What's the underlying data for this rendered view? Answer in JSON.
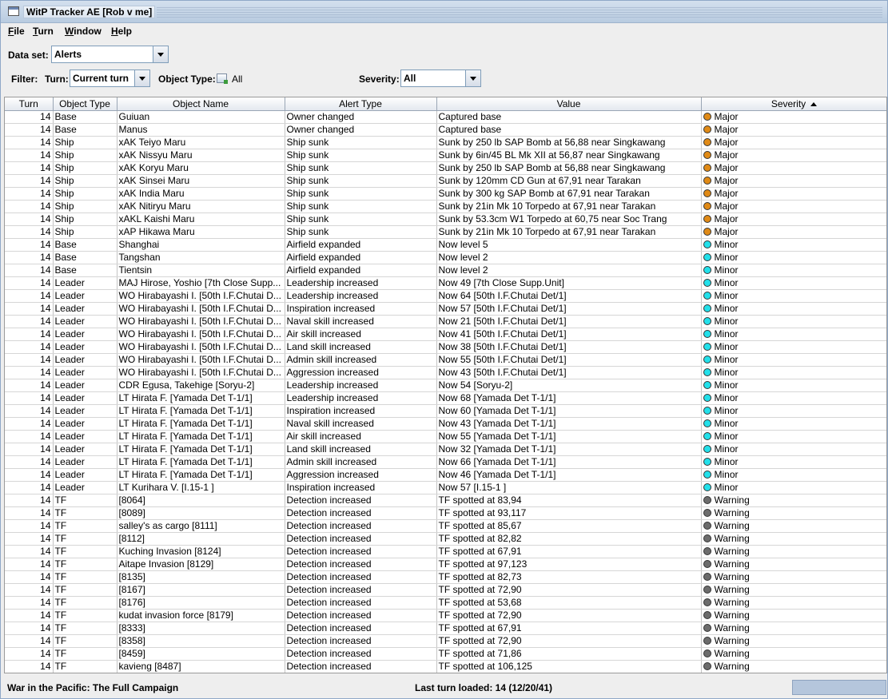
{
  "window": {
    "title": "WitP Tracker AE [Rob v me]"
  },
  "menu": [
    "File",
    "Turn",
    "Window",
    "Help"
  ],
  "dataset": {
    "label": "Data set:",
    "value": "Alerts"
  },
  "filter": {
    "label": "Filter:",
    "turn_label": "Turn:",
    "turn_value": "Current turn",
    "object_type_label": "Object Type:",
    "object_type_value": "All",
    "severity_label": "Severity:",
    "severity_value": "All"
  },
  "table": {
    "columns": [
      "Turn",
      "Object Type",
      "Object Name",
      "Alert Type",
      "Value",
      "Severity"
    ],
    "sorted_column": "Severity",
    "severity_colors": {
      "Major": "#e08a16",
      "Minor": "#22e0ea",
      "Warning": "#6c6c6c"
    },
    "rows": [
      [
        "14",
        "Base",
        "Guiuan",
        "Owner changed",
        "Captured base",
        "Major"
      ],
      [
        "14",
        "Base",
        "Manus",
        "Owner changed",
        "Captured base",
        "Major"
      ],
      [
        "14",
        "Ship",
        "xAK Teiyo Maru",
        "Ship sunk",
        "Sunk by 250 lb SAP Bomb at 56,88 near Singkawang",
        "Major"
      ],
      [
        "14",
        "Ship",
        "xAK Nissyu Maru",
        "Ship sunk",
        "Sunk by 6in/45 BL Mk XII at 56,87 near Singkawang",
        "Major"
      ],
      [
        "14",
        "Ship",
        "xAK Koryu Maru",
        "Ship sunk",
        "Sunk by 250 lb SAP Bomb at 56,88 near Singkawang",
        "Major"
      ],
      [
        "14",
        "Ship",
        "xAK Sinsei Maru",
        "Ship sunk",
        "Sunk by 120mm CD Gun at 67,91 near Tarakan",
        "Major"
      ],
      [
        "14",
        "Ship",
        "xAK India Maru",
        "Ship sunk",
        "Sunk by 300 kg SAP Bomb at 67,91 near Tarakan",
        "Major"
      ],
      [
        "14",
        "Ship",
        "xAK Nitiryu Maru",
        "Ship sunk",
        "Sunk by 21in Mk 10 Torpedo at 67,91 near Tarakan",
        "Major"
      ],
      [
        "14",
        "Ship",
        "xAKL Kaishi Maru",
        "Ship sunk",
        "Sunk by 53.3cm W1 Torpedo at 60,75 near Soc Trang",
        "Major"
      ],
      [
        "14",
        "Ship",
        "xAP Hikawa Maru",
        "Ship sunk",
        "Sunk by 21in Mk 10 Torpedo at 67,91 near Tarakan",
        "Major"
      ],
      [
        "14",
        "Base",
        "Shanghai",
        "Airfield expanded",
        "Now level 5",
        "Minor"
      ],
      [
        "14",
        "Base",
        "Tangshan",
        "Airfield expanded",
        "Now level 2",
        "Minor"
      ],
      [
        "14",
        "Base",
        "Tientsin",
        "Airfield expanded",
        "Now level 2",
        "Minor"
      ],
      [
        "14",
        "Leader",
        "MAJ Hirose, Yoshio [7th Close Supp...",
        "Leadership increased",
        "Now 49 [7th Close Supp.Unit]",
        "Minor"
      ],
      [
        "14",
        "Leader",
        "WO Hirabayashi I. [50th I.F.Chutai D...",
        "Leadership increased",
        "Now 64 [50th I.F.Chutai Det/1]",
        "Minor"
      ],
      [
        "14",
        "Leader",
        "WO Hirabayashi I. [50th I.F.Chutai D...",
        "Inspiration increased",
        "Now 57 [50th I.F.Chutai Det/1]",
        "Minor"
      ],
      [
        "14",
        "Leader",
        "WO Hirabayashi I. [50th I.F.Chutai D...",
        "Naval skill increased",
        "Now 21 [50th I.F.Chutai Det/1]",
        "Minor"
      ],
      [
        "14",
        "Leader",
        "WO Hirabayashi I. [50th I.F.Chutai D...",
        "Air skill increased",
        "Now 41 [50th I.F.Chutai Det/1]",
        "Minor"
      ],
      [
        "14",
        "Leader",
        "WO Hirabayashi I. [50th I.F.Chutai D...",
        "Land skill increased",
        "Now 38 [50th I.F.Chutai Det/1]",
        "Minor"
      ],
      [
        "14",
        "Leader",
        "WO Hirabayashi I. [50th I.F.Chutai D...",
        "Admin skill increased",
        "Now 55 [50th I.F.Chutai Det/1]",
        "Minor"
      ],
      [
        "14",
        "Leader",
        "WO Hirabayashi I. [50th I.F.Chutai D...",
        "Aggression increased",
        "Now 43 [50th I.F.Chutai Det/1]",
        "Minor"
      ],
      [
        "14",
        "Leader",
        "CDR Egusa, Takehige [Soryu-2]",
        "Leadership increased",
        "Now 54 [Soryu-2]",
        "Minor"
      ],
      [
        "14",
        "Leader",
        "LT Hirata F. [Yamada Det T-1/1]",
        "Leadership increased",
        "Now 68 [Yamada Det T-1/1]",
        "Minor"
      ],
      [
        "14",
        "Leader",
        "LT Hirata F. [Yamada Det T-1/1]",
        "Inspiration increased",
        "Now 60 [Yamada Det T-1/1]",
        "Minor"
      ],
      [
        "14",
        "Leader",
        "LT Hirata F. [Yamada Det T-1/1]",
        "Naval skill increased",
        "Now 43 [Yamada Det T-1/1]",
        "Minor"
      ],
      [
        "14",
        "Leader",
        "LT Hirata F. [Yamada Det T-1/1]",
        "Air skill increased",
        "Now 55 [Yamada Det T-1/1]",
        "Minor"
      ],
      [
        "14",
        "Leader",
        "LT Hirata F. [Yamada Det T-1/1]",
        "Land skill increased",
        "Now 32 [Yamada Det T-1/1]",
        "Minor"
      ],
      [
        "14",
        "Leader",
        "LT Hirata F. [Yamada Det T-1/1]",
        "Admin skill increased",
        "Now 66 [Yamada Det T-1/1]",
        "Minor"
      ],
      [
        "14",
        "Leader",
        "LT Hirata F. [Yamada Det T-1/1]",
        "Aggression increased",
        "Now 46 [Yamada Det T-1/1]",
        "Minor"
      ],
      [
        "14",
        "Leader",
        "LT Kurihara V. [I.15-1 ]",
        "Inspiration increased",
        "Now 57 [I.15-1 ]",
        "Minor"
      ],
      [
        "14",
        "TF",
        " [8064]",
        "Detection increased",
        "TF spotted at 83,94",
        "Warning"
      ],
      [
        "14",
        "TF",
        " [8089]",
        "Detection increased",
        "TF spotted at 93,117",
        "Warning"
      ],
      [
        "14",
        "TF",
        "salley's as cargo [8111]",
        "Detection increased",
        "TF spotted at 85,67",
        "Warning"
      ],
      [
        "14",
        "TF",
        " [8112]",
        "Detection increased",
        "TF spotted at 82,82",
        "Warning"
      ],
      [
        "14",
        "TF",
        "Kuching Invasion [8124]",
        "Detection increased",
        "TF spotted at 67,91",
        "Warning"
      ],
      [
        "14",
        "TF",
        "Aitape Invasion [8129]",
        "Detection increased",
        "TF spotted at 97,123",
        "Warning"
      ],
      [
        "14",
        "TF",
        " [8135]",
        "Detection increased",
        "TF spotted at 82,73",
        "Warning"
      ],
      [
        "14",
        "TF",
        " [8167]",
        "Detection increased",
        "TF spotted at 72,90",
        "Warning"
      ],
      [
        "14",
        "TF",
        " [8176]",
        "Detection increased",
        "TF spotted at 53,68",
        "Warning"
      ],
      [
        "14",
        "TF",
        "kudat invasion force [8179]",
        "Detection increased",
        "TF spotted at 72,90",
        "Warning"
      ],
      [
        "14",
        "TF",
        " [8333]",
        "Detection increased",
        "TF spotted at 67,91",
        "Warning"
      ],
      [
        "14",
        "TF",
        " [8358]",
        "Detection increased",
        "TF spotted at 72,90",
        "Warning"
      ],
      [
        "14",
        "TF",
        " [8459]",
        "Detection increased",
        "TF spotted at 71,86",
        "Warning"
      ],
      [
        "14",
        "TF",
        "kavieng [8487]",
        "Detection increased",
        "TF spotted at 106,125",
        "Warning"
      ]
    ]
  },
  "status": {
    "left": "War in the Pacific: The Full Campaign",
    "center": "Last turn loaded: 14 (12/20/41)"
  }
}
